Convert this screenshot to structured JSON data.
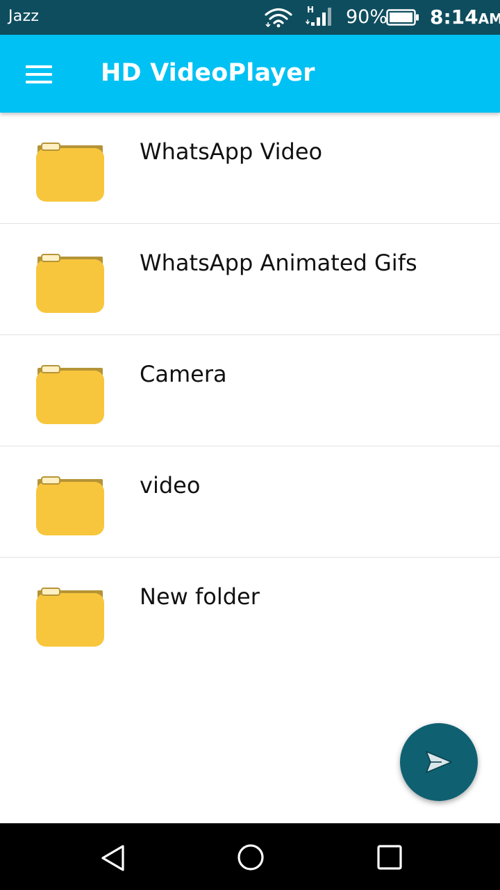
{
  "status_bar": {
    "carrier": "Jazz",
    "network_type": "H",
    "battery_percent": "90%",
    "time": "8:14",
    "ampm": "AM",
    "icons": [
      "wifi-icon",
      "signal-icon",
      "battery-icon"
    ]
  },
  "app_bar": {
    "title": "HD VideoPlayer",
    "menu_icon": "hamburger-menu-icon",
    "color": "#00c1f3"
  },
  "folders": [
    {
      "name": "WhatsApp Video",
      "icon": "folder-icon"
    },
    {
      "name": "WhatsApp Animated Gifs",
      "icon": "folder-icon"
    },
    {
      "name": "Camera",
      "icon": "folder-icon"
    },
    {
      "name": "video",
      "icon": "folder-icon"
    },
    {
      "name": "New folder",
      "icon": "folder-icon"
    }
  ],
  "fab": {
    "icon": "send-icon",
    "color": "#0f6172"
  },
  "nav_bar": {
    "icons": [
      "back-icon",
      "home-icon",
      "recents-icon"
    ]
  },
  "colors": {
    "status_bar": "#0e4d5e",
    "folder_body": "#f8c63d",
    "folder_tab": "#b59436"
  }
}
